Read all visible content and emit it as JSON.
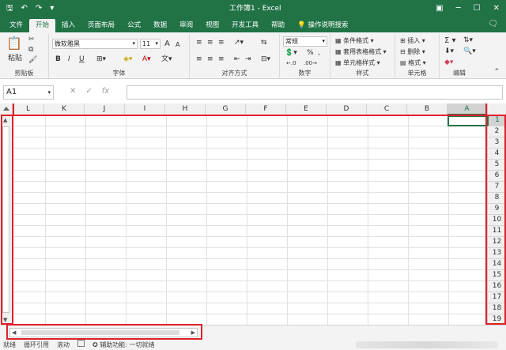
{
  "titlebar": {
    "title": "工作簿1 - Excel",
    "qa_icons": [
      "save-icon",
      "undo-icon",
      "redo-icon",
      "customize-icon"
    ],
    "window_icons": [
      "ribbon-display-icon",
      "minimize-icon",
      "restore-icon",
      "close-icon"
    ]
  },
  "tabs": [
    "文件",
    "开始",
    "插入",
    "页面布局",
    "公式",
    "数据",
    "审阅",
    "视图",
    "开发工具",
    "帮助"
  ],
  "active_tab": "开始",
  "tell_me": "操作说明搜索",
  "ribbon": {
    "clipboard": {
      "label": "剪贴板",
      "paste": "粘贴"
    },
    "font": {
      "label": "字体",
      "font_name": "微软雅黑",
      "font_size": "11",
      "bold": "B",
      "italic": "I",
      "underline": "U",
      "grow": "A",
      "shrink": "A"
    },
    "alignment": {
      "label": "对齐方式"
    },
    "number": {
      "label": "数字",
      "format": "常规",
      "percent": "%",
      "comma": ","
    },
    "styles": {
      "label": "样式",
      "cond_format": "条件格式",
      "table_format": "套用表格格式",
      "cell_styles": "单元格样式"
    },
    "cells": {
      "label": "单元格",
      "insert": "插入",
      "delete": "删除",
      "format": "格式"
    },
    "editing": {
      "label": "编辑"
    }
  },
  "formula_bar": {
    "name_box": "A1",
    "cancel": "✕",
    "enter": "✓",
    "fx": "fx",
    "value": ""
  },
  "columns": [
    "L",
    "K",
    "J",
    "I",
    "H",
    "G",
    "F",
    "E",
    "D",
    "C",
    "B",
    "A"
  ],
  "selected_column": "A",
  "rows": [
    "1",
    "2",
    "3",
    "4",
    "5",
    "6",
    "7",
    "8",
    "9",
    "10",
    "11",
    "12",
    "13",
    "14",
    "15",
    "16",
    "17",
    "18",
    "19"
  ],
  "selected_row": "1",
  "status": {
    "ready": "就绪",
    "circular": "循环引用",
    "scroll": "滚动",
    "accessibility": "辅助功能: 一切就绪"
  }
}
